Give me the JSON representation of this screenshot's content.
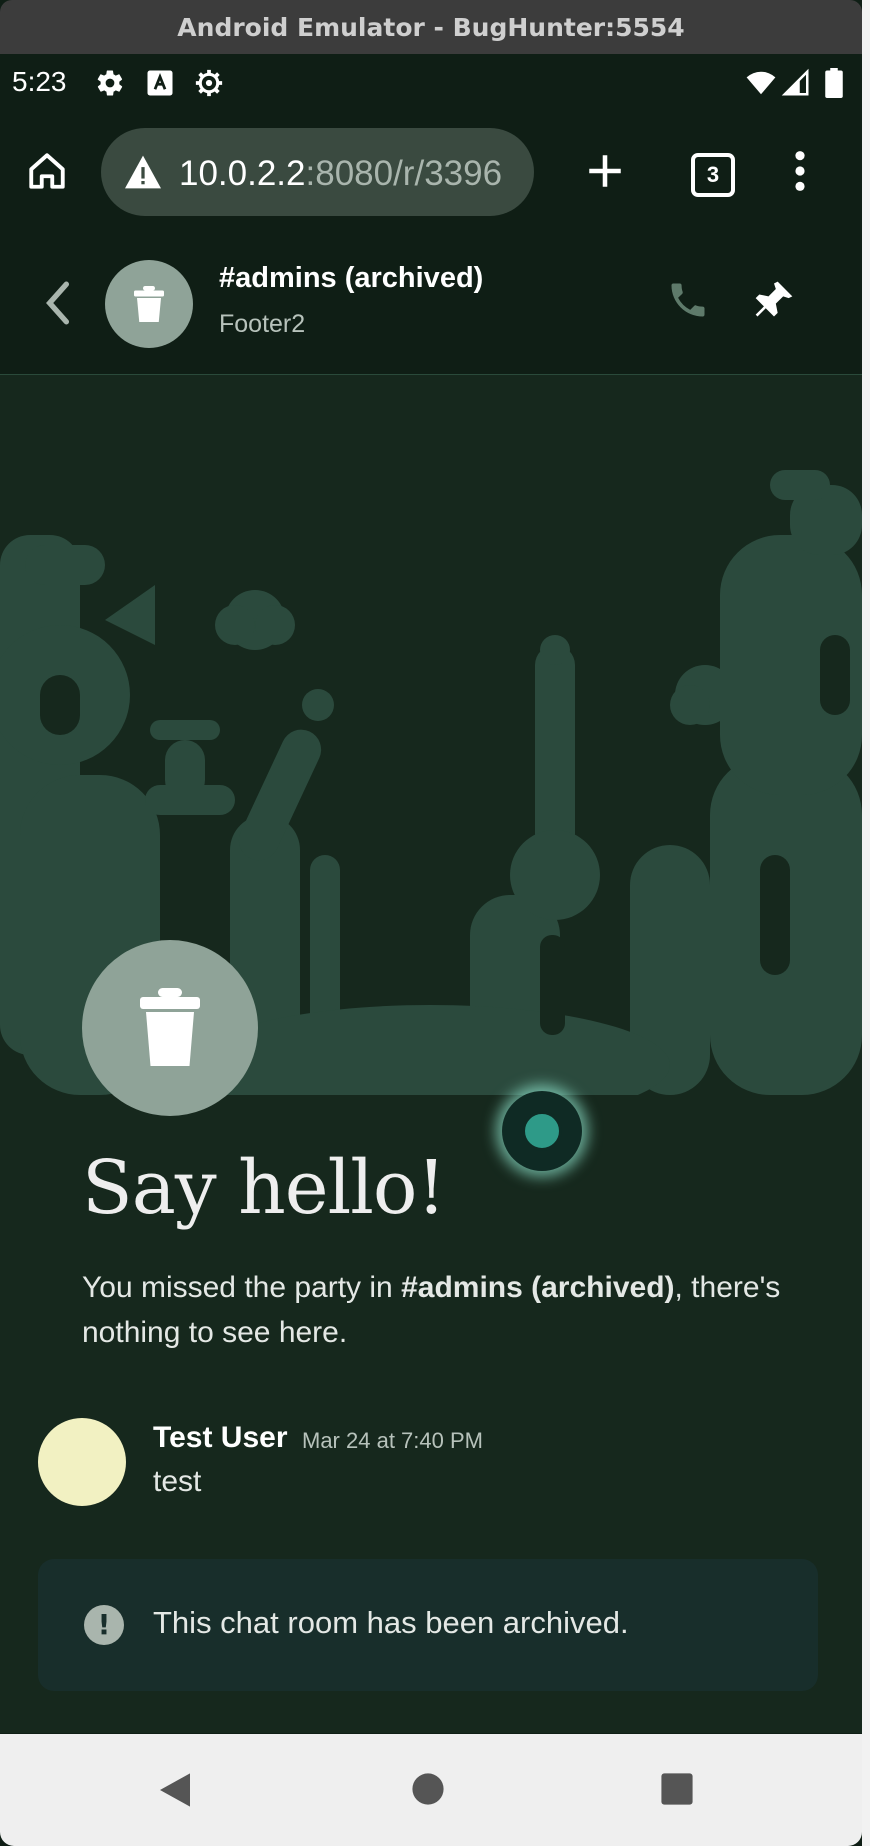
{
  "window": {
    "title": "Android Emulator - BugHunter:5554"
  },
  "status_bar": {
    "time": "5:23",
    "left_icons": [
      "settings-gear-icon",
      "font-a-icon",
      "settings-cog-icon"
    ],
    "right_icons": [
      "wifi-icon",
      "signal-icon",
      "battery-icon"
    ]
  },
  "browser": {
    "url_host": "10.0.2.2",
    "url_path": ":8080/r/3396",
    "tab_count": "3"
  },
  "room": {
    "title": "#admins (archived)",
    "subtitle": "Footer2"
  },
  "welcome": {
    "heading": "Say hello!",
    "line_prefix": "You missed the party in ",
    "room_name": "#admins (archived)",
    "line_suffix": ", there's nothing to see here."
  },
  "message": {
    "author": "Test User",
    "timestamp": "Mar 24 at 7:40 PM",
    "body": "test"
  },
  "notice": {
    "text": "This chat room has been archived."
  },
  "colors": {
    "background": "#0f1e15",
    "chat_bg": "#16281d",
    "avatar": "#8fa398",
    "user_avatar": "#f2f1c2",
    "notice_bg": "#182e2b"
  }
}
